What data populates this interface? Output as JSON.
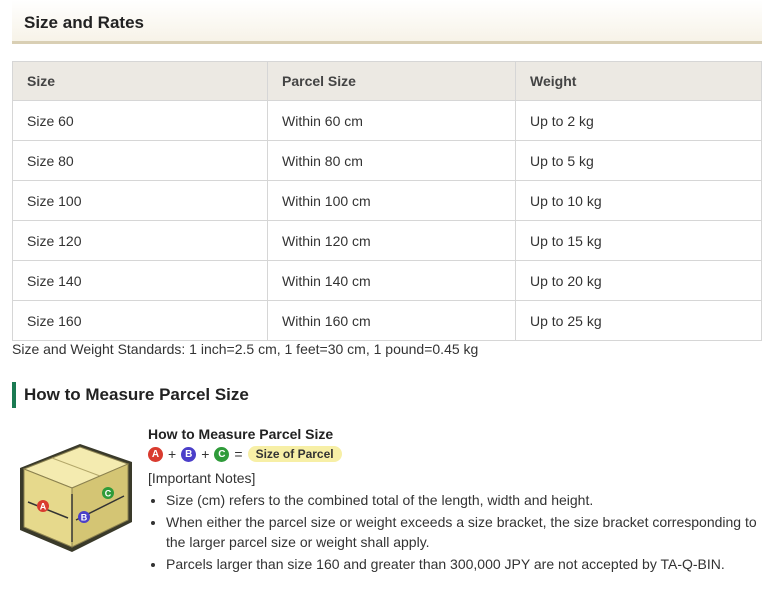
{
  "header": {
    "title": "Size and Rates"
  },
  "table": {
    "columns": [
      "Size",
      "Parcel Size",
      "Weight"
    ],
    "rows": [
      [
        "Size 60",
        "Within 60 cm",
        "Up to 2 kg"
      ],
      [
        "Size 80",
        "Within 80 cm",
        "Up to 5 kg"
      ],
      [
        "Size 100",
        "Within 100 cm",
        "Up to 10 kg"
      ],
      [
        "Size 120",
        "Within 120 cm",
        "Up to 15 kg"
      ],
      [
        "Size 140",
        "Within 140 cm",
        "Up to 20 kg"
      ],
      [
        "Size 160",
        "Within 160 cm",
        "Up to 25 kg"
      ]
    ]
  },
  "standards_note": "Size and Weight Standards: 1 inch=2.5 cm, 1 feet=30 cm, 1 pound=0.45 kg",
  "measure": {
    "heading": "How to Measure Parcel Size",
    "illustration_title": "How to Measure Parcel Size",
    "formula": {
      "a": "A",
      "b": "B",
      "c": "C",
      "plus": "+",
      "equals": "=",
      "result": "Size of Parcel"
    },
    "important_label": "[Important Notes]",
    "notes": [
      "Size (cm) refers to the combined total of the length, width and height.",
      "When either the parcel size or weight exceeds a size bracket, the size bracket corresponding to the larger parcel size or weight shall apply.",
      "Parcels larger than size 160 and greater than 300,000 JPY are not accepted by TA-Q-BIN."
    ]
  },
  "colors": {
    "accent_green": "#1a7a52",
    "label_a": "#d93b2f",
    "label_b": "#4b3fc9",
    "label_c": "#2f9b3a",
    "header_rule": "#d9cfb4"
  },
  "icons": [
    "parcel-box-icon"
  ]
}
